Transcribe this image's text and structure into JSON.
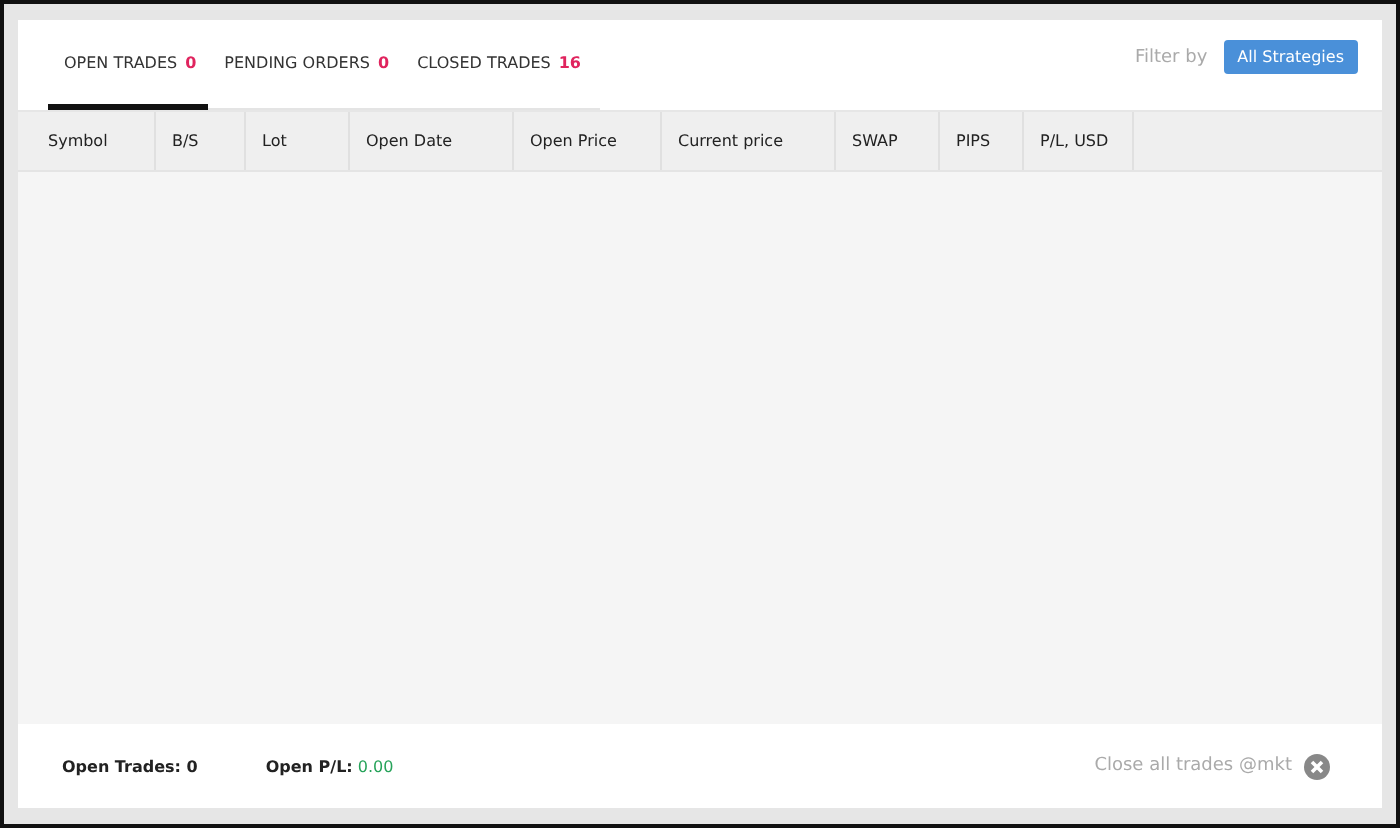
{
  "tabs": [
    {
      "label": "OPEN TRADES",
      "count": "0",
      "selected": true
    },
    {
      "label": "PENDING ORDERS",
      "count": "0",
      "selected": false
    },
    {
      "label": "CLOSED TRADES",
      "count": "16",
      "selected": false
    }
  ],
  "filter": {
    "label": "Filter by",
    "button": "All Strategies"
  },
  "table": {
    "columns": [
      "Symbol",
      "B/S",
      "Lot",
      "Open Date",
      "Open Price",
      "Current price",
      "SWAP",
      "PIPS",
      "P/L, USD"
    ]
  },
  "footer": {
    "open_trades_label": "Open Trades:",
    "open_trades_value": "0",
    "open_pl_label": "Open P/L:",
    "open_pl_value": "0.00",
    "close_all": "Close all trades @mkt"
  }
}
